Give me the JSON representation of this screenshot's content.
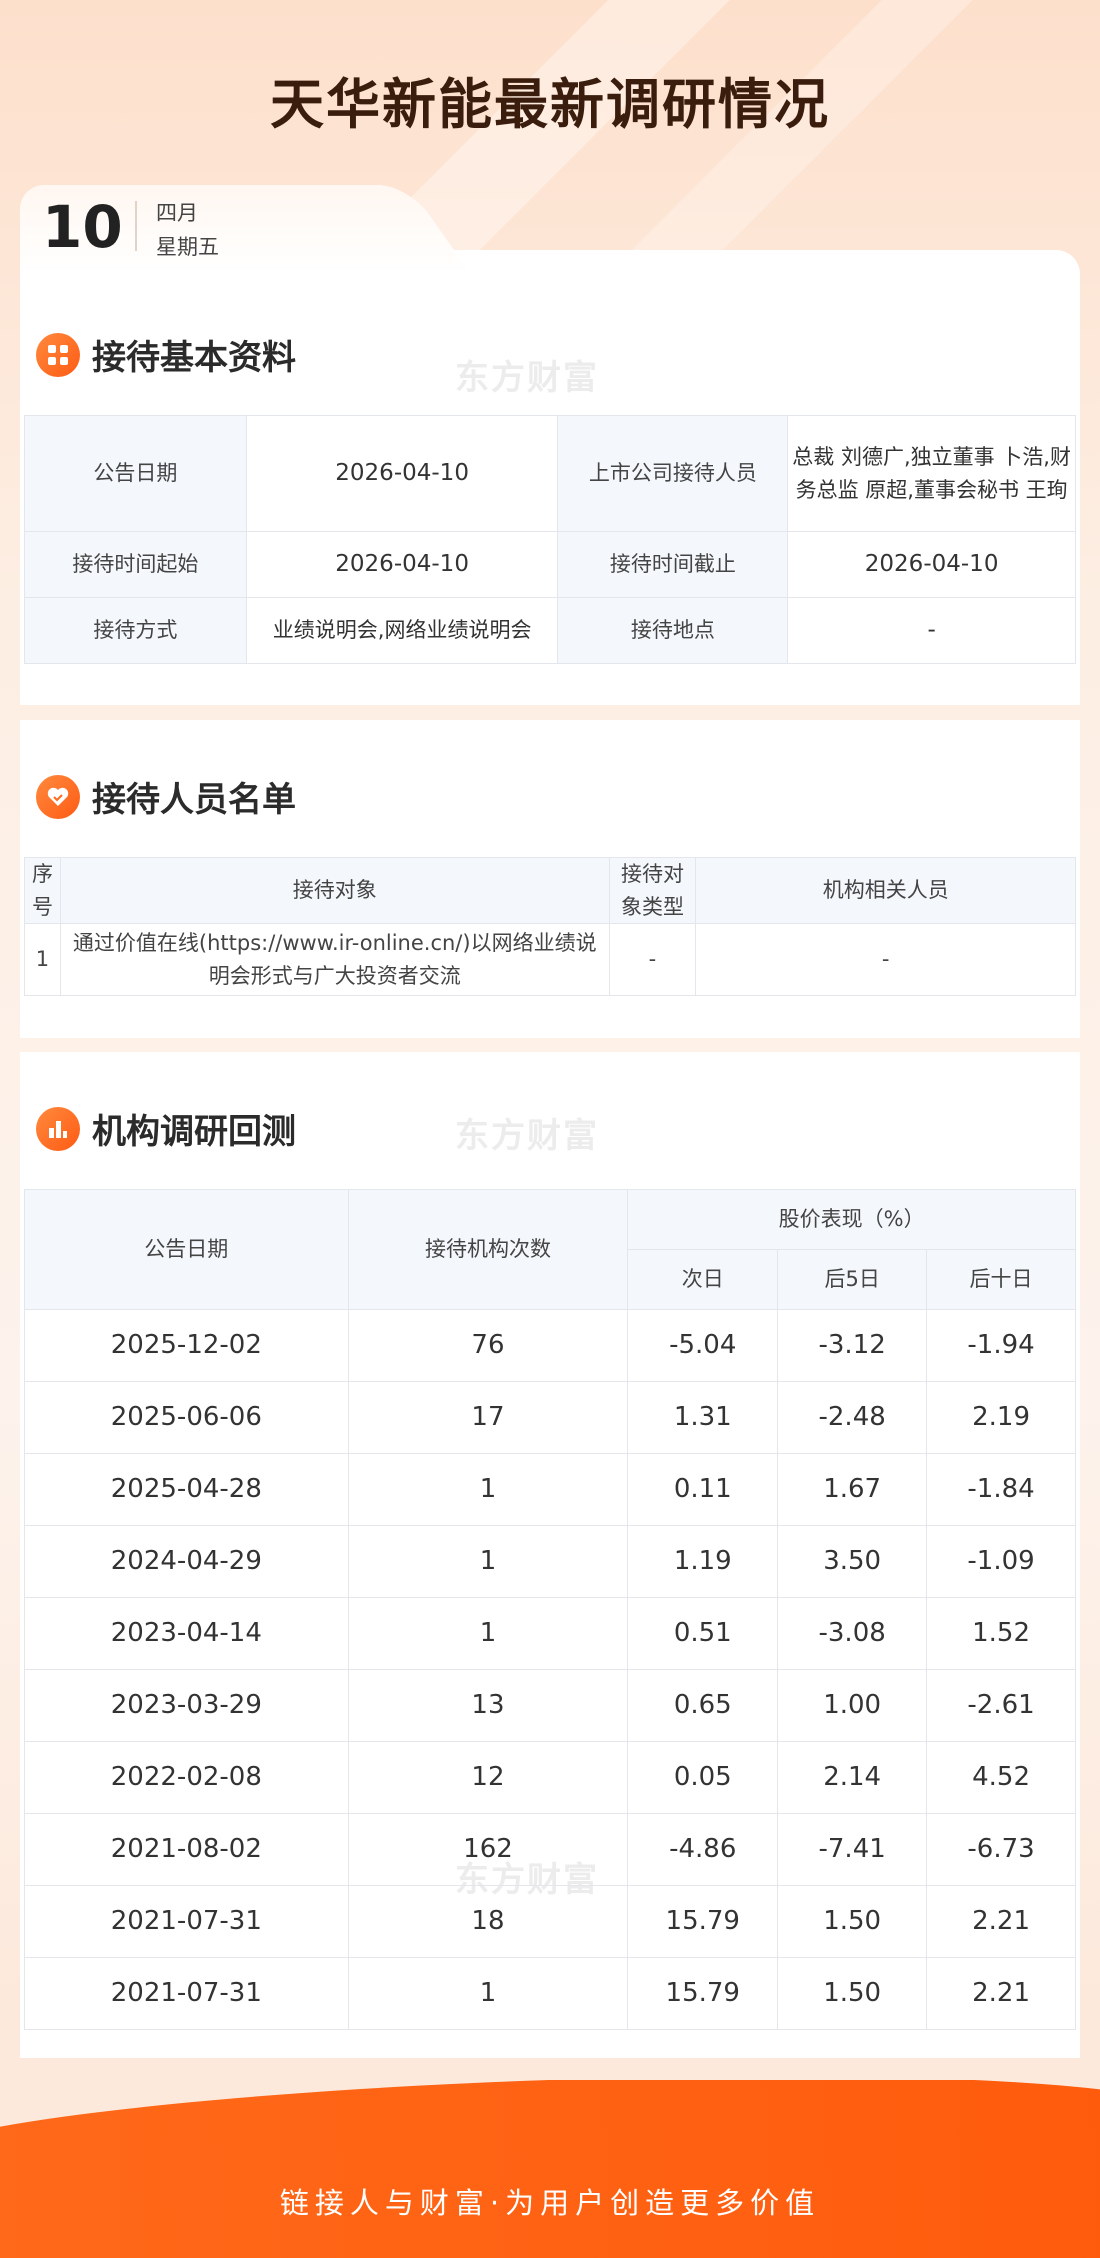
{
  "page_title": "天华新能最新调研情况",
  "date": {
    "day": "10",
    "month": "四月",
    "weekday": "星期五"
  },
  "watermark": "东方财富",
  "section1": {
    "title": "接待基本资料",
    "rows": [
      {
        "label1": "公告日期",
        "value1": "2026-04-10",
        "label2": "上市公司接待人员",
        "value2": "总裁 刘德广,独立董事 卜浩,财务总监 原超,董事会秘书 王珣"
      },
      {
        "label1": "接待时间起始",
        "value1": "2026-04-10",
        "label2": "接待时间截止",
        "value2": "2026-04-10"
      },
      {
        "label1": "接待方式",
        "value1": "业绩说明会,网络业绩说明会",
        "label2": "接待地点",
        "value2": "-"
      }
    ]
  },
  "section2": {
    "title": "接待人员名单",
    "headers": [
      "序号",
      "接待对象",
      "接待对象类型",
      "机构相关人员"
    ],
    "rows": [
      {
        "no": "1",
        "target": "通过价值在线(https://www.ir-online.cn/)以网络业绩说明会形式与广大投资者交流",
        "type": "-",
        "staff": "-"
      }
    ]
  },
  "section3": {
    "title": "机构调研回测",
    "headers": {
      "date": "公告日期",
      "count": "接待机构次数",
      "perf": "股价表现（%）",
      "d1": "次日",
      "d5": "后5日",
      "d10": "后十日"
    },
    "rows": [
      {
        "date": "2025-12-02",
        "count": "76",
        "d1": "-5.04",
        "d5": "-3.12",
        "d10": "-1.94"
      },
      {
        "date": "2025-06-06",
        "count": "17",
        "d1": "1.31",
        "d5": "-2.48",
        "d10": "2.19"
      },
      {
        "date": "2025-04-28",
        "count": "1",
        "d1": "0.11",
        "d5": "1.67",
        "d10": "-1.84"
      },
      {
        "date": "2024-04-29",
        "count": "1",
        "d1": "1.19",
        "d5": "3.50",
        "d10": "-1.09"
      },
      {
        "date": "2023-04-14",
        "count": "1",
        "d1": "0.51",
        "d5": "-3.08",
        "d10": "1.52"
      },
      {
        "date": "2023-03-29",
        "count": "13",
        "d1": "0.65",
        "d5": "1.00",
        "d10": "-2.61"
      },
      {
        "date": "2022-02-08",
        "count": "12",
        "d1": "0.05",
        "d5": "2.14",
        "d10": "4.52"
      },
      {
        "date": "2021-08-02",
        "count": "162",
        "d1": "-4.86",
        "d5": "-7.41",
        "d10": "-6.73"
      },
      {
        "date": "2021-07-31",
        "count": "18",
        "d1": "15.79",
        "d5": "1.50",
        "d10": "2.21"
      },
      {
        "date": "2021-07-31",
        "count": "1",
        "d1": "15.79",
        "d5": "1.50",
        "d10": "2.21"
      }
    ]
  },
  "footer": "链接人与财富·为用户创造更多价值"
}
